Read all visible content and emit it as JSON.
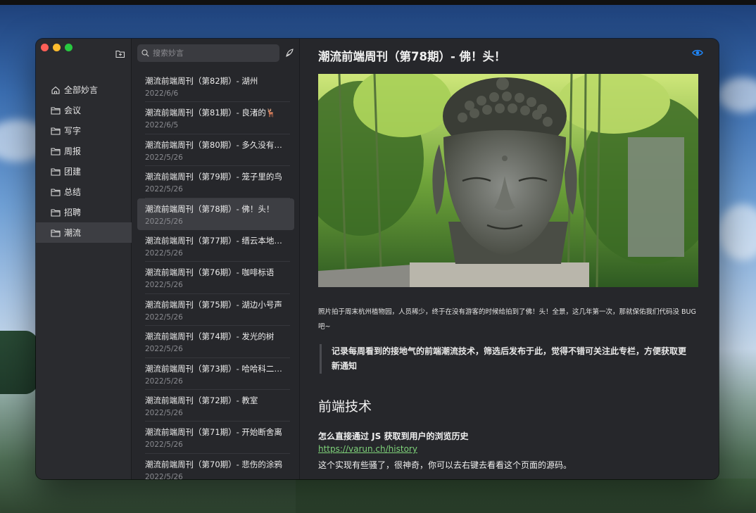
{
  "sidebar": {
    "folders": [
      {
        "label": "全部妙言",
        "icon": "home-icon"
      },
      {
        "label": "会议",
        "icon": "folder-icon"
      },
      {
        "label": "写字",
        "icon": "folder-icon"
      },
      {
        "label": "周报",
        "icon": "folder-icon"
      },
      {
        "label": "团建",
        "icon": "folder-icon"
      },
      {
        "label": "总结",
        "icon": "folder-icon"
      },
      {
        "label": "招聘",
        "icon": "folder-icon"
      },
      {
        "label": "潮流",
        "icon": "folder-icon"
      }
    ],
    "active_index": 7
  },
  "search": {
    "placeholder": "搜索妙言"
  },
  "notes": [
    {
      "title": "潮流前端周刊（第82期）- 湖州",
      "date": "2022/6/6"
    },
    {
      "title": "潮流前端周刊（第81期）- 良渚的🦌",
      "date": "2022/6/5"
    },
    {
      "title": "潮流前端周刊（第80期）- 多久没有…",
      "date": "2022/5/26"
    },
    {
      "title": "潮流前端周刊（第79期）- 笼子里的鸟",
      "date": "2022/5/26"
    },
    {
      "title": "潮流前端周刊（第78期）- 佛！头！",
      "date": "2022/5/26"
    },
    {
      "title": "潮流前端周刊（第77期）- 缙云本地…",
      "date": "2022/5/26"
    },
    {
      "title": "潮流前端周刊（第76期）- 咖啡标语",
      "date": "2022/5/26"
    },
    {
      "title": "潮流前端周刊（第75期）- 湖边小号声",
      "date": "2022/5/26"
    },
    {
      "title": "潮流前端周刊（第74期）- 发光的树",
      "date": "2022/5/26"
    },
    {
      "title": "潮流前端周刊（第73期）- 哈哈科二…",
      "date": "2022/5/26"
    },
    {
      "title": "潮流前端周刊（第72期）- 教室",
      "date": "2022/5/26"
    },
    {
      "title": "潮流前端周刊（第71期）- 开始断舍离",
      "date": "2022/5/26"
    },
    {
      "title": "潮流前端周刊（第70期）- 悲伤的涂鸦",
      "date": "2022/5/26"
    }
  ],
  "active_note": 4,
  "article": {
    "title": "潮流前端周刊（第78期）- 佛！头！",
    "caption": "照片拍于周末杭州植物园，人员稀少，终于在没有游客的时候给拍到了佛！头！全景，这几年第一次，那就保佑我们代码没 BUG 吧~",
    "quote": "记录每周看到的接地气的前端潮流技术，筛选后发布于此，觉得不错可关注此专栏，方便获取更新通知",
    "section_heading": "前端技术",
    "entry_title": "怎么直接通过 JS 获取到用户的浏览历史",
    "entry_link": "https://varun.ch/history",
    "entry_text": "这个实现有些骚了，很神奇，你可以去右键去看看这个页面的源码。"
  },
  "colors": {
    "accent_eye": "#1e88ff",
    "link": "#7fd37a"
  }
}
